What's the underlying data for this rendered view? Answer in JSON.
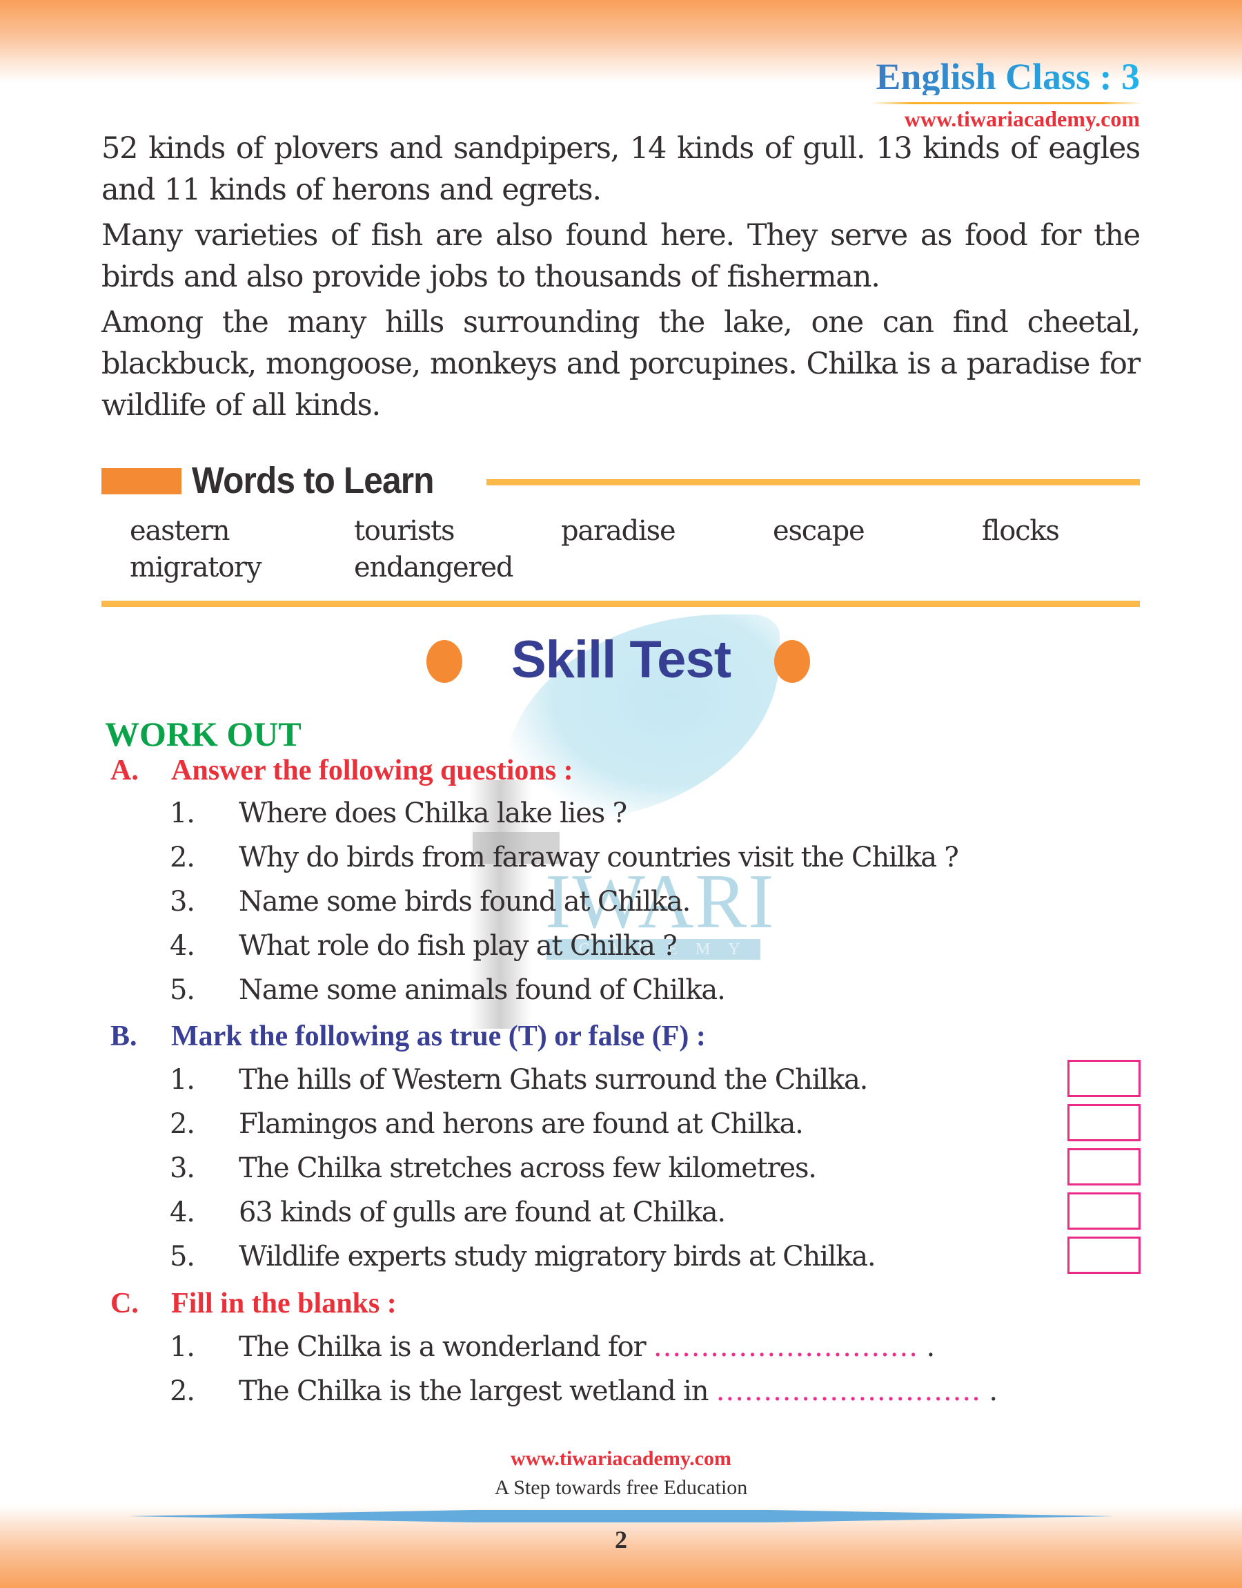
{
  "header": {
    "title": "English Class : 3",
    "url": "www.tiwariacademy.com"
  },
  "watermark": {
    "brand": "IWARI",
    "sub": "ACADEMY"
  },
  "passage": [
    "52 kinds of plovers and sandpipers, 14 kinds of gull. 13 kinds of eagles and 11 kinds of herons and egrets.",
    "Many varieties of fish are also found here. They serve as food for the birds and also provide jobs to thousands of fisherman.",
    "Among the many hills surrounding the lake, one can find cheetal, blackbuck, mongoose, monkeys and porcupines. Chilka is a paradise for wildlife of all kinds."
  ],
  "words_to_learn": {
    "heading": "Words to Learn",
    "words": [
      "eastern",
      "tourists",
      "paradise",
      "escape",
      "flocks",
      "migratory",
      "endangered"
    ]
  },
  "skill_test": {
    "title": "Skill Test",
    "work_out": "WORK OUT",
    "section_a": {
      "letter": "A.",
      "title": "Answer the following questions :",
      "items": [
        {
          "num": "1.",
          "text": "Where does Chilka lake lies ?"
        },
        {
          "num": "2.",
          "text": "Why do birds from faraway countries visit the Chilka ?"
        },
        {
          "num": "3.",
          "text": "Name some birds found at Chilka."
        },
        {
          "num": "4.",
          "text": "What role do fish play at Chilka ?"
        },
        {
          "num": "5.",
          "text": "Name some animals found of Chilka."
        }
      ]
    },
    "section_b": {
      "letter": "B.",
      "title": "Mark the following as true (T) or false (F) :",
      "items": [
        {
          "num": "1.",
          "text": "The hills of Western Ghats surround the Chilka.",
          "answer": ""
        },
        {
          "num": "2.",
          "text": "Flamingos and herons are found at Chilka.",
          "answer": ""
        },
        {
          "num": "3.",
          "text": "The Chilka stretches across few kilometres.",
          "answer": ""
        },
        {
          "num": "4.",
          "text": "63 kinds of gulls are found at Chilka.",
          "answer": ""
        },
        {
          "num": "5.",
          "text": "Wildlife experts study migratory birds at Chilka.",
          "answer": ""
        }
      ]
    },
    "section_c": {
      "letter": "C.",
      "title": "Fill in the blanks :",
      "items": [
        {
          "num": "1.",
          "text": "The Chilka is a wonderland for",
          "blank": "............................",
          "end": "."
        },
        {
          "num": "2.",
          "text": "The Chilka is the largest wetland in",
          "blank": "............................",
          "end": "."
        }
      ]
    }
  },
  "footer": {
    "url": "www.tiwariacademy.com",
    "tagline": "A Step towards free Education",
    "page_number": "2"
  },
  "colors": {
    "band_orange": "#f9a05a",
    "accent_orange": "#f58a34",
    "rule_yellow": "#fdb949",
    "title_blue": "#373f93",
    "section_red": "#e8313a",
    "workout_green": "#0aa34a",
    "box_pink": "#ec2a8a",
    "footer_blue": "#63abdd"
  }
}
